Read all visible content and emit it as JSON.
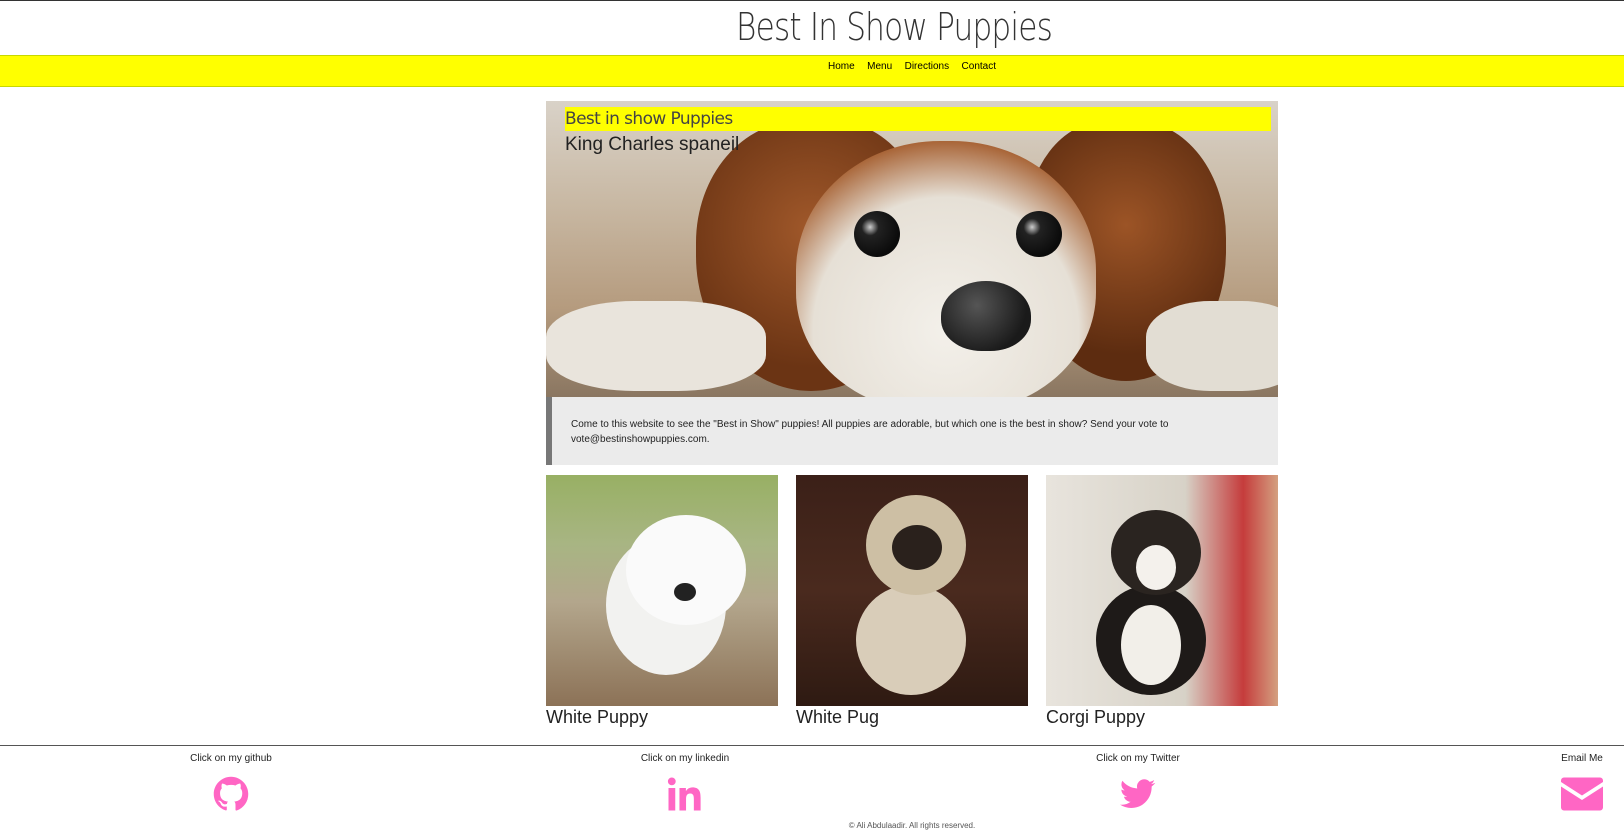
{
  "header": {
    "title": "Best In Show Puppies"
  },
  "nav": {
    "items": [
      "Home",
      "Menu",
      "Directions",
      "Contact"
    ]
  },
  "hero": {
    "heading": "Best in show Puppies",
    "subtitle": "King Charles spaneil",
    "description": "Come to this website to see the \"Best in Show\" puppies! All puppies are adorable, but which one is the best in show? Send your vote to vote@bestinshowpuppies.com."
  },
  "cards": [
    {
      "caption": "White Puppy"
    },
    {
      "caption": "White Pug"
    },
    {
      "caption": "Corgi Puppy"
    }
  ],
  "footer": {
    "github": "Click on my github",
    "linkedin": "Click on my linkedin",
    "twitter": "Click on my Twitter",
    "email": "Email Me",
    "copyright": "© Ali Abdulaadir. All rights reserved.",
    "icon_color": "#ff66c4"
  },
  "colors": {
    "accent": "#ffff00"
  }
}
